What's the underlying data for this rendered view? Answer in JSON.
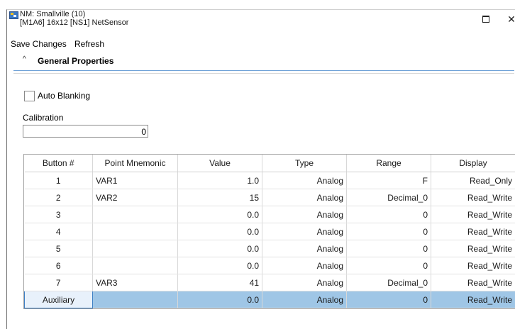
{
  "window": {
    "title_line1": "NM: Smallville (10)",
    "title_line2": "[M1A6] 16x12 [NS1] NetSensor",
    "maximize_symbol": "□",
    "close_symbol": "✕"
  },
  "menu": {
    "save_changes": "Save Changes",
    "refresh": "Refresh"
  },
  "section": {
    "chevron": "^",
    "title": "General Properties"
  },
  "form": {
    "auto_blanking_label": "Auto Blanking",
    "auto_blanking_checked": false,
    "calibration_label": "Calibration",
    "calibration_value": "0"
  },
  "grid": {
    "headers": [
      "Button #",
      "Point Mnemonic",
      "Value",
      "Type",
      "Range",
      "Display"
    ],
    "rows": [
      {
        "button": "1",
        "mnemonic": "VAR1",
        "value": "1.0",
        "type": "Analog",
        "range": "F",
        "display": "Read_Only"
      },
      {
        "button": "2",
        "mnemonic": "VAR2",
        "value": "15",
        "type": "Analog",
        "range": "Decimal_0",
        "display": "Read_Write"
      },
      {
        "button": "3",
        "mnemonic": "",
        "value": "0.0",
        "type": "Analog",
        "range": "0",
        "display": "Read_Write"
      },
      {
        "button": "4",
        "mnemonic": "",
        "value": "0.0",
        "type": "Analog",
        "range": "0",
        "display": "Read_Write"
      },
      {
        "button": "5",
        "mnemonic": "",
        "value": "0.0",
        "type": "Analog",
        "range": "0",
        "display": "Read_Write"
      },
      {
        "button": "6",
        "mnemonic": "",
        "value": "0.0",
        "type": "Analog",
        "range": "0",
        "display": "Read_Write"
      },
      {
        "button": "7",
        "mnemonic": "VAR3",
        "value": "41",
        "type": "Analog",
        "range": "Decimal_0",
        "display": "Read_Write"
      },
      {
        "button": "Auxiliary",
        "mnemonic": "",
        "value": "0.0",
        "type": "Analog",
        "range": "0",
        "display": "Read_Write"
      }
    ],
    "selected_row": 7
  },
  "colors": {
    "selection": "#9fc6e6",
    "section_rule": "#6fa2d8"
  }
}
